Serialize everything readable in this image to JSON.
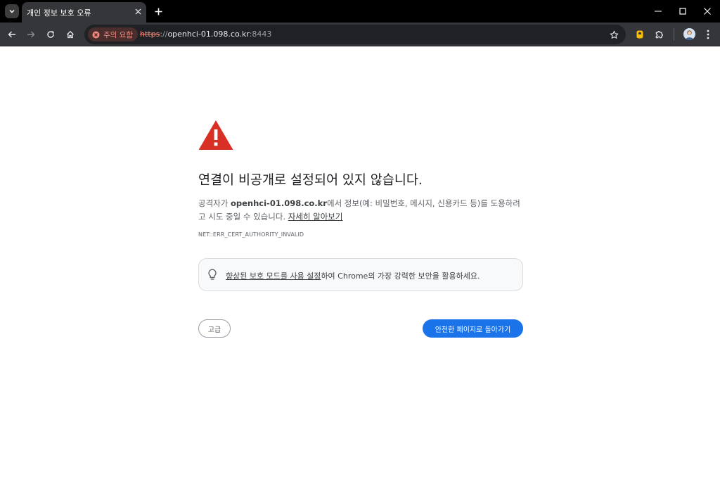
{
  "window": {
    "tab_title": "개인 정보 보호 오류",
    "controls": [
      "minimize-icon",
      "maximize-icon",
      "close-icon"
    ]
  },
  "toolbar": {
    "security_chip": "주의 요함",
    "url": {
      "scheme": "https",
      "separator": "://",
      "host": "openhci-01.098.co.kr",
      "port": ":8443"
    },
    "icons": [
      "back-icon",
      "forward-icon",
      "reload-icon",
      "home-icon",
      "star-icon",
      "extension-icon",
      "puzzle-icon",
      "avatar",
      "more-icon"
    ]
  },
  "page": {
    "heading": "연결이 비공개로 설정되어 있지 않습니다.",
    "description": {
      "prefix": "공격자가 ",
      "host": "openhci-01.098.co.kr",
      "middle": "에서 정보(예: 비밀번호, 메시지, 신용카드 등)를 도용하려고 시도 중일 수 있습니다. ",
      "learn_more": "자세히 알아보기"
    },
    "error_code": "NET::ERR_CERT_AUTHORITY_INVALID",
    "enhanced_protection": {
      "link_text": "향상된 보호 모드를 사용 설정",
      "rest_text": "하여 Chrome의 가장 강력한 보안을 활용하세요."
    },
    "advanced_button": "고급",
    "back_button": "안전한 페이지로 돌아가기"
  },
  "colors": {
    "warning_red": "#d93025",
    "primary_blue": "#1a73e8",
    "toolbar_bg": "#35363a",
    "tabstrip_bg": "#000000"
  }
}
